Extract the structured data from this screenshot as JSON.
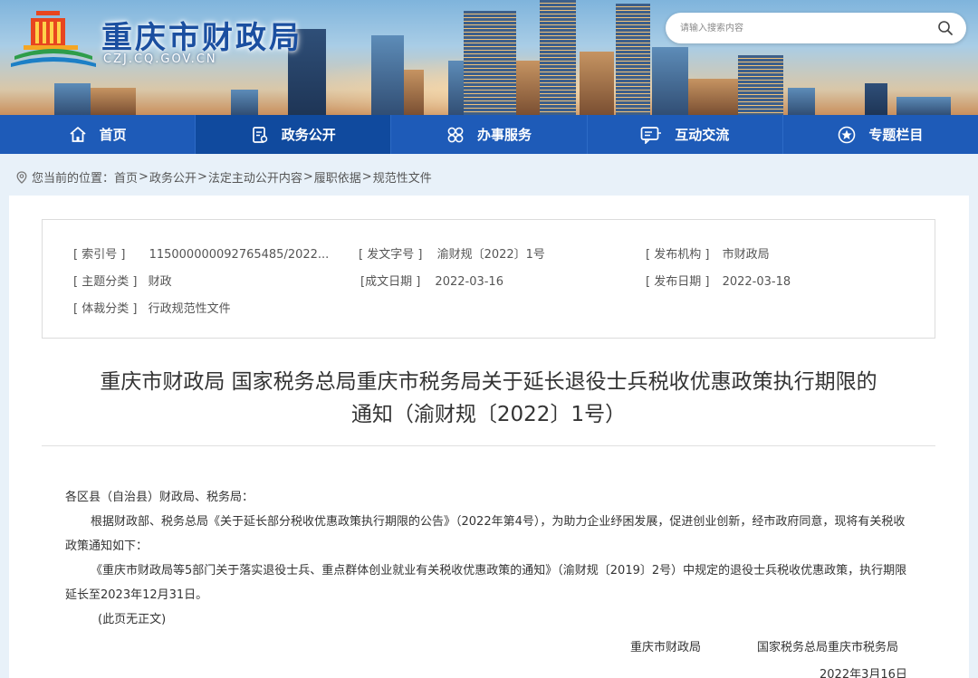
{
  "header": {
    "site_title": "重庆市财政局",
    "domain": "CZJ.CQ.GOV.CN",
    "search_placeholder": "请输入搜索内容",
    "logo_icon": "logo-building-emblem"
  },
  "nav": {
    "items": [
      {
        "label": "首页",
        "icon": "home-icon"
      },
      {
        "label": "政务公开",
        "icon": "document-icon"
      },
      {
        "label": "办事服务",
        "icon": "service-icon"
      },
      {
        "label": "互动交流",
        "icon": "chat-icon"
      },
      {
        "label": "专题栏目",
        "icon": "star-icon"
      }
    ],
    "active_index": 1
  },
  "breadcrumb": {
    "prefix": "您当前的位置：",
    "items": [
      "首页",
      "政务公开",
      "法定主动公开内容",
      "履职依据",
      "规范性文件"
    ],
    "separator": ">"
  },
  "meta": {
    "index_label": "[ 索引号 ]",
    "index_value": "115000000092765485/2022...",
    "doc_no_label": "[ 发文字号 ]",
    "doc_no_value": "渝财规〔2022〕1号",
    "publisher_label": "[ 发布机构 ]",
    "publisher_value": "市财政局",
    "topic_label": "[ 主题分类 ]",
    "topic_value": "财政",
    "created_label": "[成文日期 ]",
    "created_value": "2022-03-16",
    "published_label": "[ 发布日期 ]",
    "published_value": "2022-03-18",
    "genre_label": "[ 体裁分类 ]",
    "genre_value": "行政规范性文件"
  },
  "document": {
    "title_line1": "重庆市财政局 国家税务总局重庆市税务局关于延长退役士兵税收优惠政策执行期限的",
    "title_line2": "通知（渝财规〔2022〕1号）",
    "salutation": "各区县（自治县）财政局、税务局：",
    "para1": "根据财政部、税务总局《关于延长部分税收优惠政策执行期限的公告》（2022年第4号），为助力企业纾困发展，促进创业创新，经市政府同意，现将有关税收政策通知如下：",
    "para2": "《重庆市财政局等5部门关于落实退役士兵、重点群体创业就业有关税收优惠政策的通知》（渝财规〔2019〕2号）中规定的退役士兵税收优惠政策，执行期限延长至2023年12月31日。",
    "note": "(此页无正文)",
    "signer1": "重庆市财政局",
    "signer2": "国家税务总局重庆市税务局",
    "date": "2022年3月16日"
  }
}
